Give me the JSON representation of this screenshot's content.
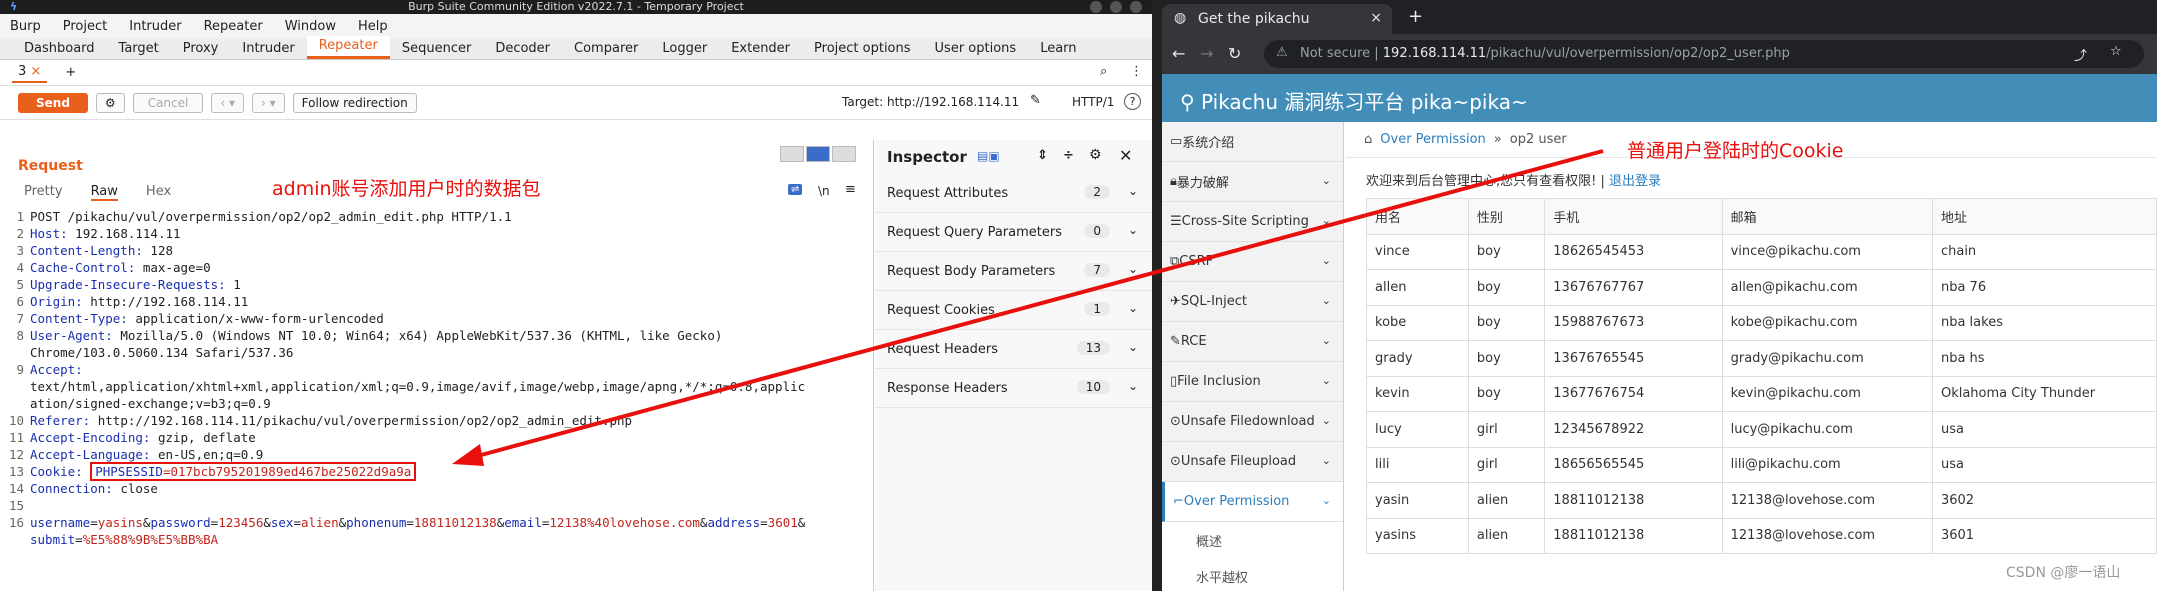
{
  "burp": {
    "title": "Burp Suite Community Edition v2022.7.1 - Temporary Project",
    "menu": [
      "Burp",
      "Project",
      "Intruder",
      "Repeater",
      "Window",
      "Help"
    ],
    "tabs": [
      "Dashboard",
      "Target",
      "Proxy",
      "Intruder",
      "Repeater",
      "Sequencer",
      "Decoder",
      "Comparer",
      "Logger",
      "Extender",
      "Project options",
      "User options",
      "Learn"
    ],
    "active_tab": "Repeater",
    "subtab": "3",
    "subtab_close": "×",
    "subtab_add": "+",
    "send": "Send",
    "cancel": "Cancel",
    "follow": "Follow redirection",
    "target": "Target: http://192.168.114.11",
    "http_version": "HTTP/1",
    "request_title": "Request",
    "request_tabs": [
      "Pretty",
      "Raw",
      "Hex"
    ],
    "active_request_tab": "Raw",
    "annotation": "admin账号添加用户时的数据包",
    "newline_btn": "\\n",
    "request_lines": [
      {
        "n": "1",
        "k": "",
        "v": "POST /pikachu/vul/overpermission/op2/op2_admin_edit.php HTTP/1.1"
      },
      {
        "n": "2",
        "k": "Host:",
        "v": " 192.168.114.11"
      },
      {
        "n": "3",
        "k": "Content-Length:",
        "v": " 128"
      },
      {
        "n": "4",
        "k": "Cache-Control:",
        "v": " max-age=0"
      },
      {
        "n": "5",
        "k": "Upgrade-Insecure-Requests:",
        "v": " 1"
      },
      {
        "n": "6",
        "k": "Origin:",
        "v": " http://192.168.114.11"
      },
      {
        "n": "7",
        "k": "Content-Type:",
        "v": " application/x-www-form-urlencoded"
      },
      {
        "n": "8",
        "k": "User-Agent:",
        "v": " Mozilla/5.0 (Windows NT 10.0; Win64; x64) AppleWebKit/537.36 (KHTML, like Gecko)"
      },
      {
        "n": "",
        "k": "",
        "v": "Chrome/103.0.5060.134 Safari/537.36"
      },
      {
        "n": "9",
        "k": "Accept:",
        "v": ""
      },
      {
        "n": "",
        "k": "",
        "v": "text/html,application/xhtml+xml,application/xml;q=0.9,image/avif,image/webp,image/apng,*/*;q=0.8,applic"
      },
      {
        "n": "",
        "k": "",
        "v": "ation/signed-exchange;v=b3;q=0.9"
      },
      {
        "n": "10",
        "k": "Referer:",
        "v": " http://192.168.114.11/pikachu/vul/overpermission/op2/op2_admin_edit.php"
      },
      {
        "n": "11",
        "k": "Accept-Encoding:",
        "v": " gzip, deflate"
      },
      {
        "n": "12",
        "k": "Accept-Language:",
        "v": " en-US,en;q=0.9"
      }
    ],
    "cookie_line": {
      "n": "13",
      "k": "Cookie:",
      "name": "PHPSESSID",
      "val": "=017bcb795201989ed467be25022d9a9a"
    },
    "connection_line": {
      "n": "14",
      "k": "Connection:",
      "v": " close"
    },
    "empty_line": "15",
    "body_line_n": "16",
    "body_params": [
      {
        "k": "username",
        "v": "yasins"
      },
      {
        "k": "password",
        "v": "123456"
      },
      {
        "k": "sex",
        "v": "alien"
      },
      {
        "k": "phonenum",
        "v": "18811012138"
      },
      {
        "k": "email",
        "v": "12138%40lovehose.com"
      },
      {
        "k": "address",
        "v": "3601"
      }
    ],
    "body_cont": {
      "k": "submit",
      "v": "%E5%88%9B%E5%BB%BA"
    },
    "inspector": {
      "title": "Inspector",
      "rows": [
        {
          "label": "Request Attributes",
          "count": "2"
        },
        {
          "label": "Request Query Parameters",
          "count": "0"
        },
        {
          "label": "Request Body Parameters",
          "count": "7"
        },
        {
          "label": "Request Cookies",
          "count": "1"
        },
        {
          "label": "Request Headers",
          "count": "13"
        },
        {
          "label": "Response Headers",
          "count": "10"
        }
      ]
    }
  },
  "browser": {
    "tab_title": "Get the pikachu",
    "tab_close": "×",
    "new_tab": "+",
    "not_secure": "Not secure",
    "url_host": "192.168.114.11",
    "url_path": "/pikachu/vul/overpermission/op2/op2_user.php",
    "header": "Pikachu 漏洞练习平台 pika~pika~",
    "sidebar": [
      {
        "label": "系统介绍"
      },
      {
        "label": "暴力破解"
      },
      {
        "label": "Cross-Site Scripting"
      },
      {
        "label": "CSRF"
      },
      {
        "label": "SQL-Inject"
      },
      {
        "label": "RCE"
      },
      {
        "label": "File Inclusion"
      },
      {
        "label": "Unsafe Filedownload"
      },
      {
        "label": "Unsafe Fileupload"
      },
      {
        "label": "Over Permission"
      }
    ],
    "sub_items": [
      "概述",
      "水平越权"
    ],
    "breadcrumb": {
      "section": "Over Permission",
      "sep": "»",
      "page": "op2 user"
    },
    "welcome": "欢迎来到后台管理中心,您只有查看权限! |",
    "logout": "退出登录",
    "columns": [
      "用名",
      "性别",
      "手机",
      "邮箱",
      "地址"
    ],
    "rows": [
      [
        "vince",
        "boy",
        "18626545453",
        "vince@pikachu.com",
        "chain"
      ],
      [
        "allen",
        "boy",
        "13676767767",
        "allen@pikachu.com",
        "nba 76"
      ],
      [
        "kobe",
        "boy",
        "15988767673",
        "kobe@pikachu.com",
        "nba lakes"
      ],
      [
        "grady",
        "boy",
        "13676765545",
        "grady@pikachu.com",
        "nba hs"
      ],
      [
        "kevin",
        "boy",
        "13677676754",
        "kevin@pikachu.com",
        "Oklahoma City Thunder"
      ],
      [
        "lucy",
        "girl",
        "12345678922",
        "lucy@pikachu.com",
        "usa"
      ],
      [
        "lili",
        "girl",
        "18656565545",
        "lili@pikachu.com",
        "usa"
      ],
      [
        "yasin",
        "alien",
        "18811012138",
        "12138@lovehose.com",
        "3602"
      ],
      [
        "yasins",
        "alien",
        "18811012138",
        "12138@lovehose.com",
        "3601"
      ]
    ]
  },
  "annotation_right": "普通用户登陆时的Cookie",
  "watermark": "CSDN @廖一语山",
  "colors": {
    "accent": "#e8601c",
    "annotation": "#e8100c",
    "pikachu_header": "#438eb9",
    "link": "#2b7dbc"
  }
}
